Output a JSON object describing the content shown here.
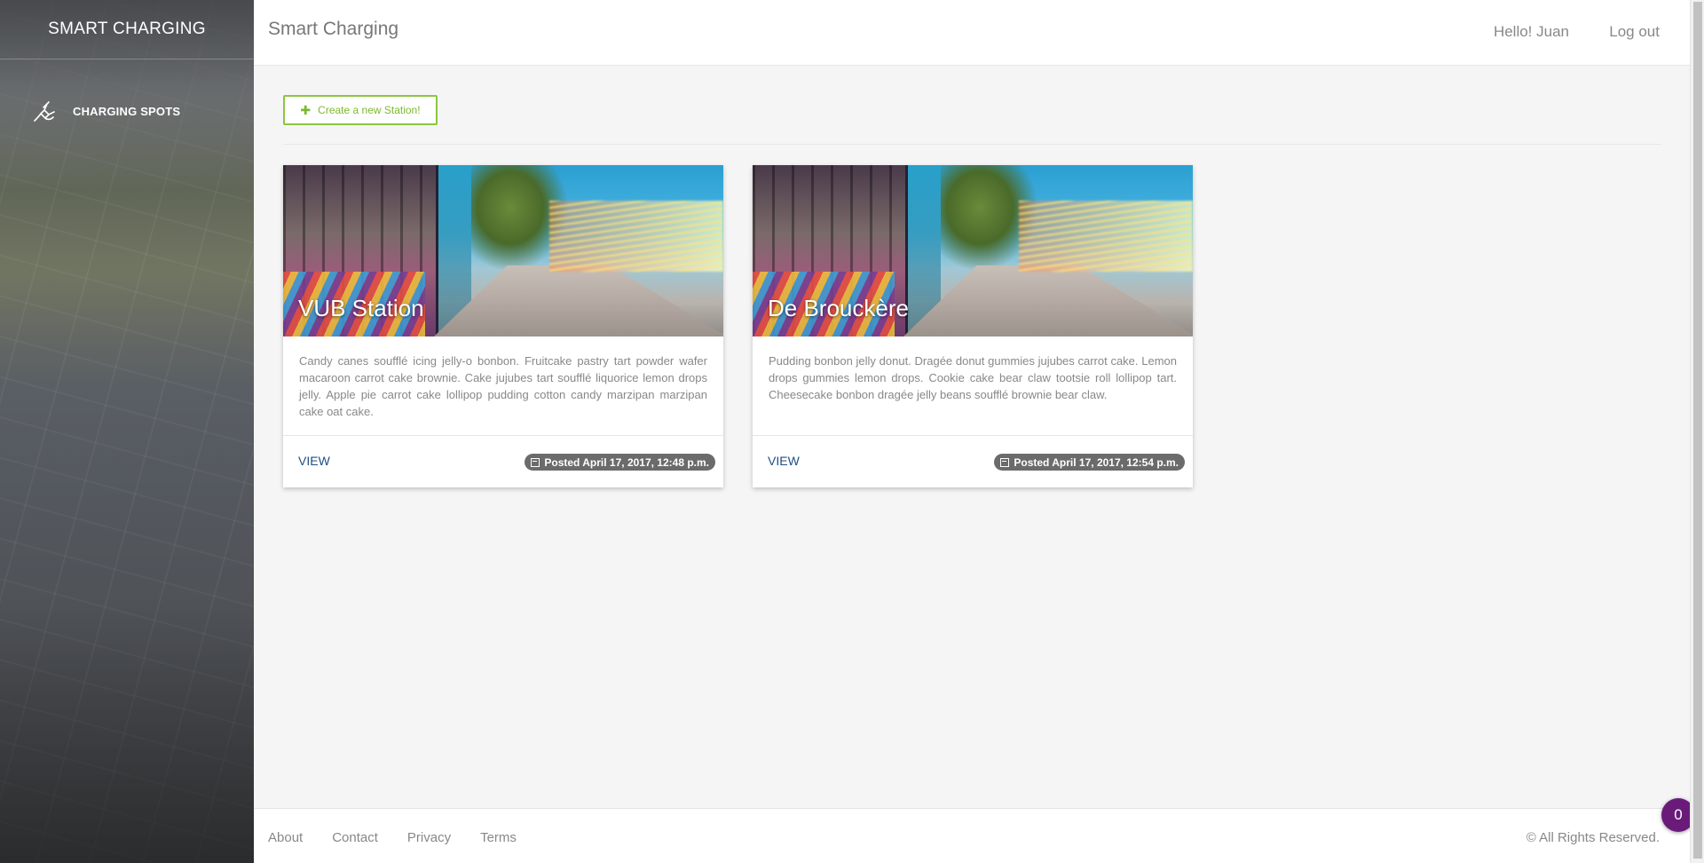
{
  "sidebar": {
    "brand": "SMART CHARGING",
    "items": [
      {
        "label": "CHARGING SPOTS",
        "icon": "ev-plug-icon"
      }
    ]
  },
  "topbar": {
    "title": "Smart Charging",
    "greeting": "Hello! Juan",
    "logout": "Log out"
  },
  "main": {
    "create_button": {
      "icon": "plus-icon",
      "label": "Create a new Station!"
    },
    "stations": [
      {
        "name": "VUB Station",
        "description": "Candy canes soufflé icing jelly-o bonbon. Fruitcake pastry tart powder wafer macaroon carrot cake brownie. Cake jujubes tart soufflé liquorice lemon drops jelly. Apple pie carrot cake lollipop pudding cotton candy marzipan marzipan cake oat cake.",
        "view_label": "VIEW",
        "posted": "Posted April 17, 2017, 12:48 p.m."
      },
      {
        "name": "De Brouckère",
        "description": "Pudding bonbon jelly donut. Dragée donut gummies jujubes carrot cake. Lemon drops gummies lemon drops. Cookie cake bear claw tootsie roll lollipop tart. Cheesecake bonbon dragée jelly beans soufflé brownie bear claw.",
        "view_label": "VIEW",
        "posted": "Posted April 17, 2017, 12:54 p.m."
      }
    ]
  },
  "footer": {
    "links": [
      "About",
      "Contact",
      "Privacy",
      "Terms"
    ],
    "copyright": "© All Rights Reserved."
  },
  "notification_count": "0",
  "colors": {
    "accent_green": "#8cc63f",
    "link_blue": "#1e4f84",
    "badge_purple": "#6a1b7a"
  }
}
